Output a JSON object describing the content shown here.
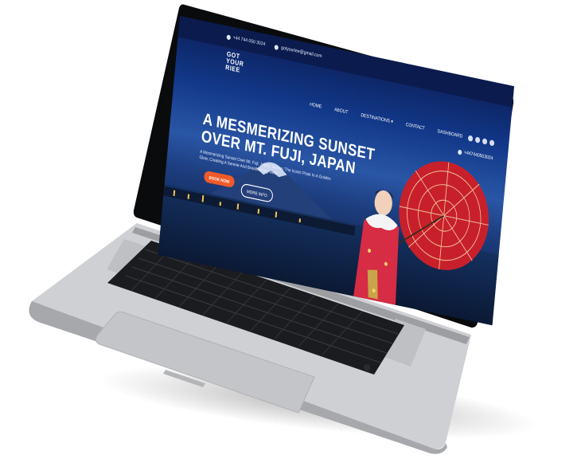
{
  "topbar": {
    "phone": "+44 744 050 3024",
    "email": "gotyouriee@gmail.com"
  },
  "logo": {
    "line1": "GOT",
    "line2": "YOUR",
    "line3": "RIEE"
  },
  "nav": {
    "items": [
      "HOME",
      "ABOUT",
      "DESTINATIONS ▾",
      "CONTACT",
      "DASHBOARD"
    ]
  },
  "contact": {
    "phone": "+447440503024"
  },
  "hero": {
    "title_line1": "A MESMERIZING SUNSET",
    "title_line2": "OVER MT. FUJI, JAPAN",
    "subtitle": "A Mesmerizing Sunset Over Mt. Fuji, Japan, Bathes The Iconic Peak In A Golden Glow, Creating A Serene And Breathtaking View.",
    "book_label": "BOOK NOW",
    "more_label": "MORE INFO"
  },
  "icons": {
    "phone": "phone-icon",
    "email": "email-icon",
    "social": [
      "facebook-icon",
      "twitter-icon",
      "instagram-icon",
      "youtube-icon"
    ]
  },
  "colors": {
    "accent": "#f05a28",
    "topbar": "#0b1b4d",
    "laptop_body": "#c9cacd",
    "keyboard": "#1b1c1f"
  }
}
